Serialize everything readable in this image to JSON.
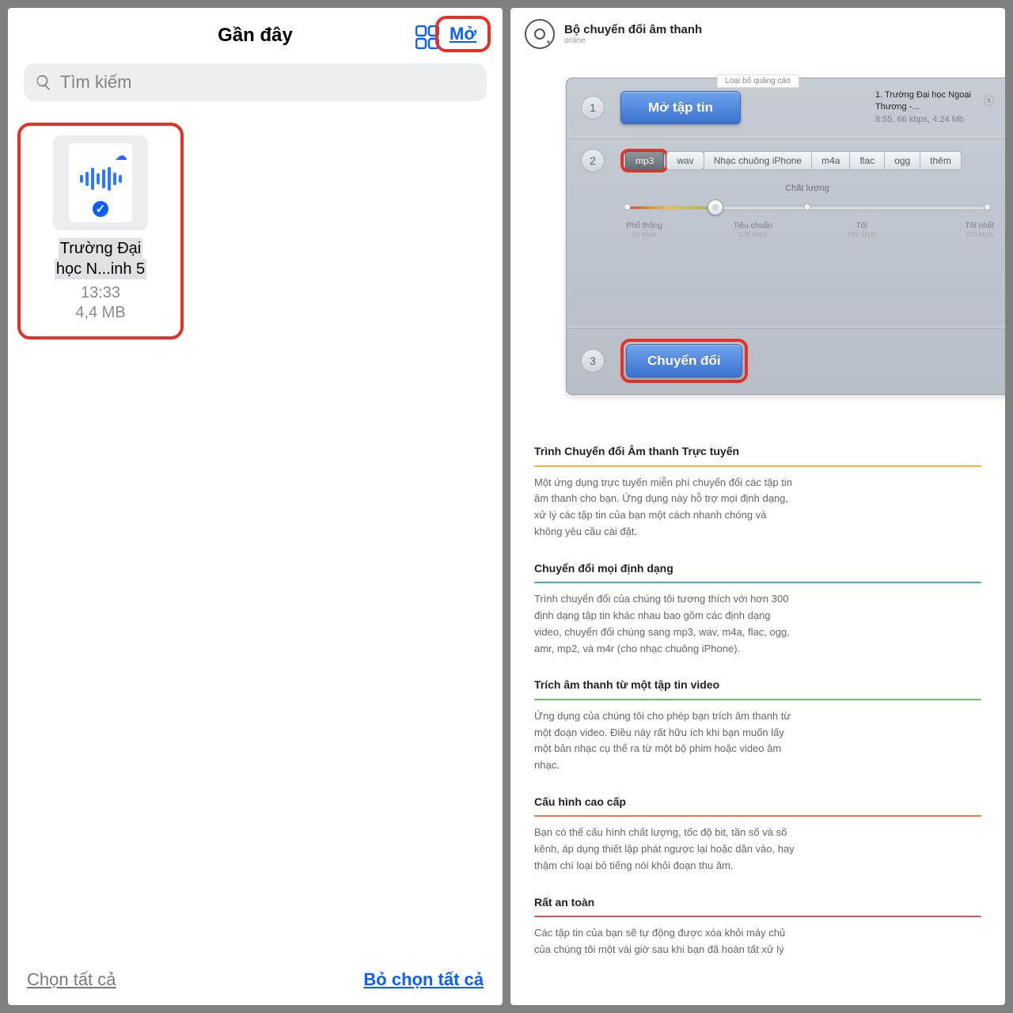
{
  "left": {
    "title": "Gần đây",
    "open": "Mở",
    "search_placeholder": "Tìm kiếm",
    "file": {
      "name_l1": "Trường Đại",
      "name_l2": "học N...inh 5",
      "time": "13:33",
      "size": "4,4 MB"
    },
    "select_all": "Chọn tất cả",
    "deselect_all": "Bỏ chọn tất cả"
  },
  "right": {
    "title": "Bộ chuyển đổi âm thanh",
    "status": "online",
    "ad_label": "Loại bỏ quảng cáo",
    "step1": {
      "num": "1",
      "button": "Mở tập tin",
      "file_name": "1.  Trường Đại học Ngoại Thương -...",
      "file_meta": "8:55, 66 kbps, 4.24 Mb"
    },
    "step2": {
      "num": "2",
      "formats": [
        "mp3",
        "wav",
        "Nhạc chuông iPhone",
        "m4a",
        "flac",
        "ogg",
        "thêm"
      ],
      "quality_label": "Chất lượng",
      "ticks": [
        {
          "name": "Phổ thông",
          "kbps": "64 kbps"
        },
        {
          "name": "Tiêu chuẩn",
          "kbps": "128 kbps"
        },
        {
          "name": "Tốt",
          "kbps": "192 kbps"
        },
        {
          "name": "Tốt nhất",
          "kbps": "320 kbps"
        }
      ]
    },
    "step3": {
      "num": "3",
      "button": "Chuyển đổi"
    },
    "sections": [
      {
        "h": "Trình Chuyển đổi Âm thanh Trực tuyến",
        "c": "#f0b43c",
        "p": "Một ứng dụng trực tuyến miễn phí chuyển đổi các tập tin âm thanh cho bạn. Ứng dụng này hỗ trợ mọi định dạng, xử lý các tập tin của bạn một cách nhanh chóng và không yêu cầu cài đặt."
      },
      {
        "h": "Chuyển đổi mọi định dạng",
        "c": "#4aa3df",
        "p": "Trình chuyển đổi của chúng tôi tương thích với hơn 300 định dạng tập tin khác nhau bao gồm các định dạng video, chuyển đổi chúng sang mp3, wav, m4a, flac, ogg, amr, mp2, và m4r (cho nhạc chuông iPhone)."
      },
      {
        "h": "Trích âm thanh từ một tập tin video",
        "c": "#6cc06c",
        "p": "Ứng dụng của chúng tôi cho phép bạn trích âm thanh từ một đoạn video. Điều này rất hữu ích khi bạn muốn lấy một bản nhạc cụ thể ra từ một bộ phim hoặc video âm nhạc."
      },
      {
        "h": "Cấu hình cao cấp",
        "c": "#e47950",
        "p": "Bạn có thể cấu hình chất lượng, tốc độ bit, tần số và số kênh, áp dụng thiết lập phát ngược lại hoặc dần vào, hay thậm chí loại bỏ tiếng nói khỏi đoạn thu âm."
      },
      {
        "h": "Rất an toàn",
        "c": "#e0524e",
        "p": "Các tập tin của bạn sẽ tự động được xóa khỏi máy chủ của chúng tôi một vài giờ sau khi bạn đã hoàn tất xử lý"
      }
    ]
  }
}
